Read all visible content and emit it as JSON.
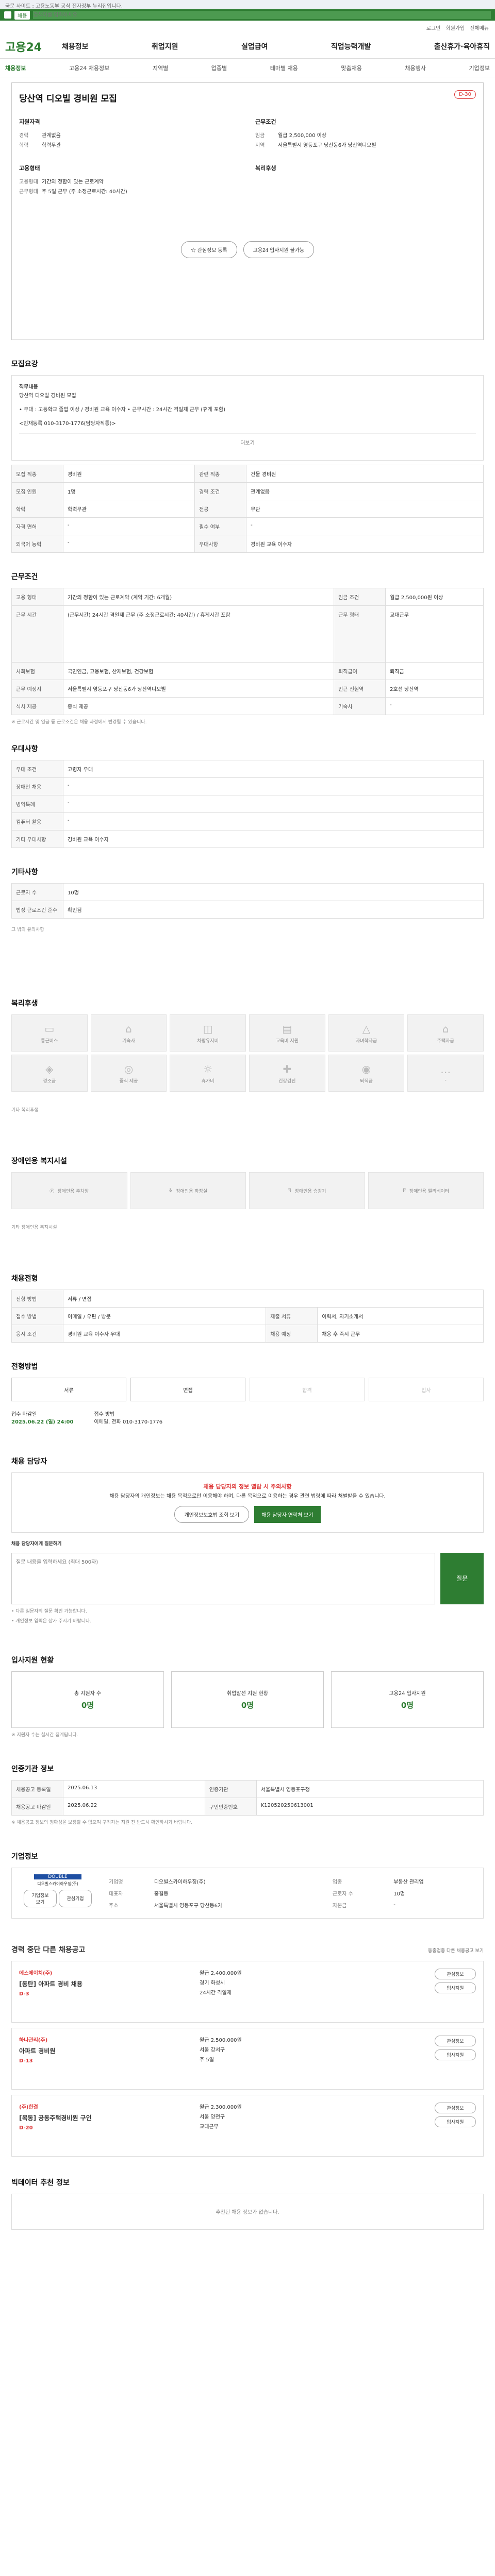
{
  "notice": "국문 사이트 : 고용노동부 공식 전자정부 누리집입니다.",
  "search": {
    "tag": "채용",
    "placeholder": "검색어를 입력하세요"
  },
  "util": [
    "로그인",
    "회원가입",
    "전체메뉴"
  ],
  "gnb": {
    "brand": "고용24",
    "menu": [
      "채용정보",
      "취업지원",
      "실업급여",
      "직업능력개발",
      "출산휴가·육아휴직"
    ]
  },
  "lnb": [
    "채용정보",
    "고용24 채용정보",
    "지역별",
    "업종별",
    "테마별 채용",
    "맞춤채용",
    "채용행사",
    "기업정보"
  ],
  "job": {
    "title": "당산역 디오빌 경비원 모집",
    "dday": "D-30",
    "pay_h": "지원자격",
    "pay": [
      {
        "k": "경력",
        "v": "관계없음"
      },
      {
        "k": "학력",
        "v": "학력무관"
      }
    ],
    "cond_h": "근무조건",
    "cond": [
      {
        "k": "임금",
        "v": "월급 2,500,000 이상"
      },
      {
        "k": "지역",
        "v": "서울특별시 영등포구 당산동6가 당산역디오빌"
      }
    ],
    "type_h": "고용형태",
    "type": [
      {
        "k": "고용형태",
        "v": "기간의 정함이 있는 근로계약"
      },
      {
        "k": "근무형태",
        "v": "주 5일 근무 (주 소정근로시간: 40시간)"
      }
    ],
    "welfare_h": "복리후생",
    "btn_interest": "관심정보 등록",
    "btn_share": "고용24 입사지원 불가능"
  },
  "recruit": {
    "title": "모집요강",
    "work_h": "직무내용",
    "work": "당산역 디오빌 경비원 모집",
    "detail": "• 우대 : 고등학교 졸업 이상 / 경비원 교육 이수자 • 근무시간 : 24시간 격일제 근무 (휴게 포함)",
    "contact": "<인재등록 010-3170-1776(담당자직통)>",
    "more": "더보기"
  },
  "recruit_table": [
    [
      "모집 직종",
      "경비원",
      "관련 직종",
      "건물 경비원"
    ],
    [
      "모집 인원",
      "1명",
      "경력 조건",
      "관계없음"
    ],
    [
      "학력",
      "학력무관",
      "전공",
      "무관"
    ],
    [
      "자격 면허",
      "-",
      "필수 여부",
      "-"
    ],
    [
      "외국어 능력",
      "-",
      "우대사항",
      "경비원 교육 이수자"
    ]
  ],
  "work_title": "근무조건",
  "work_table": [
    [
      "고용 형태",
      "기간의 정함이 있는 근로계약 (계약 기간: 6개월)",
      "임금 조건",
      "월급 2,500,000원 이상"
    ],
    [
      "근무 시간",
      "(근무시간) 24시간 격일제 근무 (주 소정근로시간: 40시간) / 휴게시간 포함",
      "근무 형태",
      "교대근무"
    ],
    [
      "사회보험",
      "국민연금, 고용보험, 산재보험, 건강보험",
      "퇴직급여",
      "퇴직금"
    ],
    [
      "근무 예정지",
      "서울특별시 영등포구 당산동6가 당산역디오빌",
      "인근 전철역",
      "2호선 당산역"
    ],
    [
      "식사 제공",
      "중식 제공",
      "기숙사",
      "-"
    ]
  ],
  "work_note": "※ 근로시간 및 임금 등 근로조건은 채용 과정에서 변경될 수 있습니다.",
  "pref_title": "우대사항",
  "pref_table": [
    [
      "우대 조건",
      "고령자 우대"
    ],
    [
      "장애인 채용",
      "-"
    ],
    [
      "병역특례",
      "-"
    ],
    [
      "컴퓨터 활용",
      "-"
    ],
    [
      "기타 우대사항",
      "경비원 교육 이수자"
    ]
  ],
  "etc_title": "기타사항",
  "etc_table": [
    [
      "근로자 수",
      "10명"
    ],
    [
      "법정 근로조건 준수",
      "확인됨"
    ]
  ],
  "etc_more": "그 밖의 유의사항",
  "welfare_title": "복리후생",
  "welfare": [
    "통근버스",
    "기숙사",
    "차량유지비",
    "교육비 지원",
    "자녀학자금",
    "주택자금",
    "경조금",
    "중식 제공",
    "휴가비",
    "건강검진",
    "퇴직금",
    "-"
  ],
  "welfare_note": "기타 복리후생",
  "facility_title": "장애인용 복지시설",
  "facility": [
    "장애인용 주차장",
    "장애인용 화장실",
    "장애인용 승강기",
    "장애인용 엘리베이터"
  ],
  "facility_note": "기타 장애인용 복지시설",
  "hire_title": "채용전형",
  "hire_table": [
    [
      "전형 방법",
      "서류 / 면접"
    ],
    [
      "접수 방법",
      "이메일 / 우편 / 방문",
      "제출 서류",
      "이력서, 자기소개서"
    ],
    [
      "응시 조건",
      "경비원 교육 이수자 우대",
      "채용 예정",
      "채용 후 즉시 근무"
    ]
  ],
  "process_title": "전형방법",
  "process": [
    "서류",
    "면접",
    "합격",
    "입사"
  ],
  "schedule": [
    {
      "k": "접수 마감일",
      "v": "2025.06.22 (일) 24:00"
    },
    {
      "k": "접수 방법",
      "v": "이메일, 전화 010-3170-1776"
    }
  ],
  "manager_title": "채용 담당자",
  "manager_warn": "채용 담당자의 정보 열람 시 주의사항",
  "manager_text": "채용 담당자의 개인정보는 채용 목적으로만 이용해야 하며, 다른 목적으로 이용하는 경우 관련 법령에 따라 처벌받을 수 있습니다.",
  "manager_btn1": "개인정보보호법 조회 보기",
  "manager_btn2": "채용 담당자 연락처 보기",
  "qna_h": "채용 담당자에게 질문하기",
  "qna_placeholder": "질문 내용을 입력하세요 (최대 500자)",
  "qna_btn": "질문",
  "qna_notes": [
    "• 다른 질문자의 질문 확인 가능합니다.",
    "• 개인정보 입력은 삼가 주시기 바랍니다."
  ],
  "apply_title": "입사지원 현황",
  "apply": [
    {
      "k": "총 지원자 수",
      "v": "0명"
    },
    {
      "k": "취업알선 지원 현황",
      "v": "0명"
    },
    {
      "k": "고용24 입사지원",
      "v": "0명"
    }
  ],
  "apply_note": "※ 지원자 수는 실시간 집계됩니다.",
  "info_title": "인증기관 정보",
  "info_table": [
    [
      "채용공고 등록일",
      "2025.06.13",
      "인증기관",
      "서울특별시 영등포구청"
    ],
    [
      "채용공고 마감일",
      "2025.06.22",
      "구인인증번호",
      "K120520250613001"
    ]
  ],
  "info_note": "※ 채용공고 정보의 정확성을 보장할 수 없으며 구직자는 지원 전 반드시 확인하시기 바랍니다.",
  "company_title": "기업정보",
  "company": {
    "logo_mark": "DOUBLE",
    "logo_text": "디오빌스카이하우징(주)",
    "btn1": "기업정보 보기",
    "btn2": "관심기업",
    "rows": [
      [
        "기업명",
        "디오빌스카이하우징(주)",
        "업종",
        "부동산 관리업"
      ],
      [
        "대표자",
        "홍길동",
        "근로자 수",
        "10명"
      ],
      [
        "주소",
        "서울특별시 영등포구 당산동6가",
        "자본금",
        "-"
      ]
    ]
  },
  "related_title": "경력 중단 다른 채용공고",
  "related_more": "동종업종 다른 채용공고 보기",
  "related": [
    {
      "org": "에스에이치(주)",
      "title": "[동탄] 아파트 경비 채용",
      "d": "D-3",
      "pay": "월급 2,400,000원",
      "loc": "경기 화성시",
      "time": "24시간 격일제",
      "b1": "관심정보",
      "b2": "입사지원"
    },
    {
      "org": "하나관리(주)",
      "title": "아파트 경비원",
      "d": "D-13",
      "pay": "월급 2,500,000원",
      "loc": "서울 강서구",
      "time": "주 5일",
      "b1": "관심정보",
      "b2": "입사지원"
    },
    {
      "org": "(주)한결",
      "title": "[목동] 공동주택경비원 구인",
      "d": "D-20",
      "pay": "월급 2,300,000원",
      "loc": "서울 양천구",
      "time": "교대근무",
      "b1": "관심정보",
      "b2": "입사지원"
    }
  ],
  "ai_title": "빅데이터 추천 정보",
  "ai_empty": "추천된 채용 정보가 없습니다."
}
